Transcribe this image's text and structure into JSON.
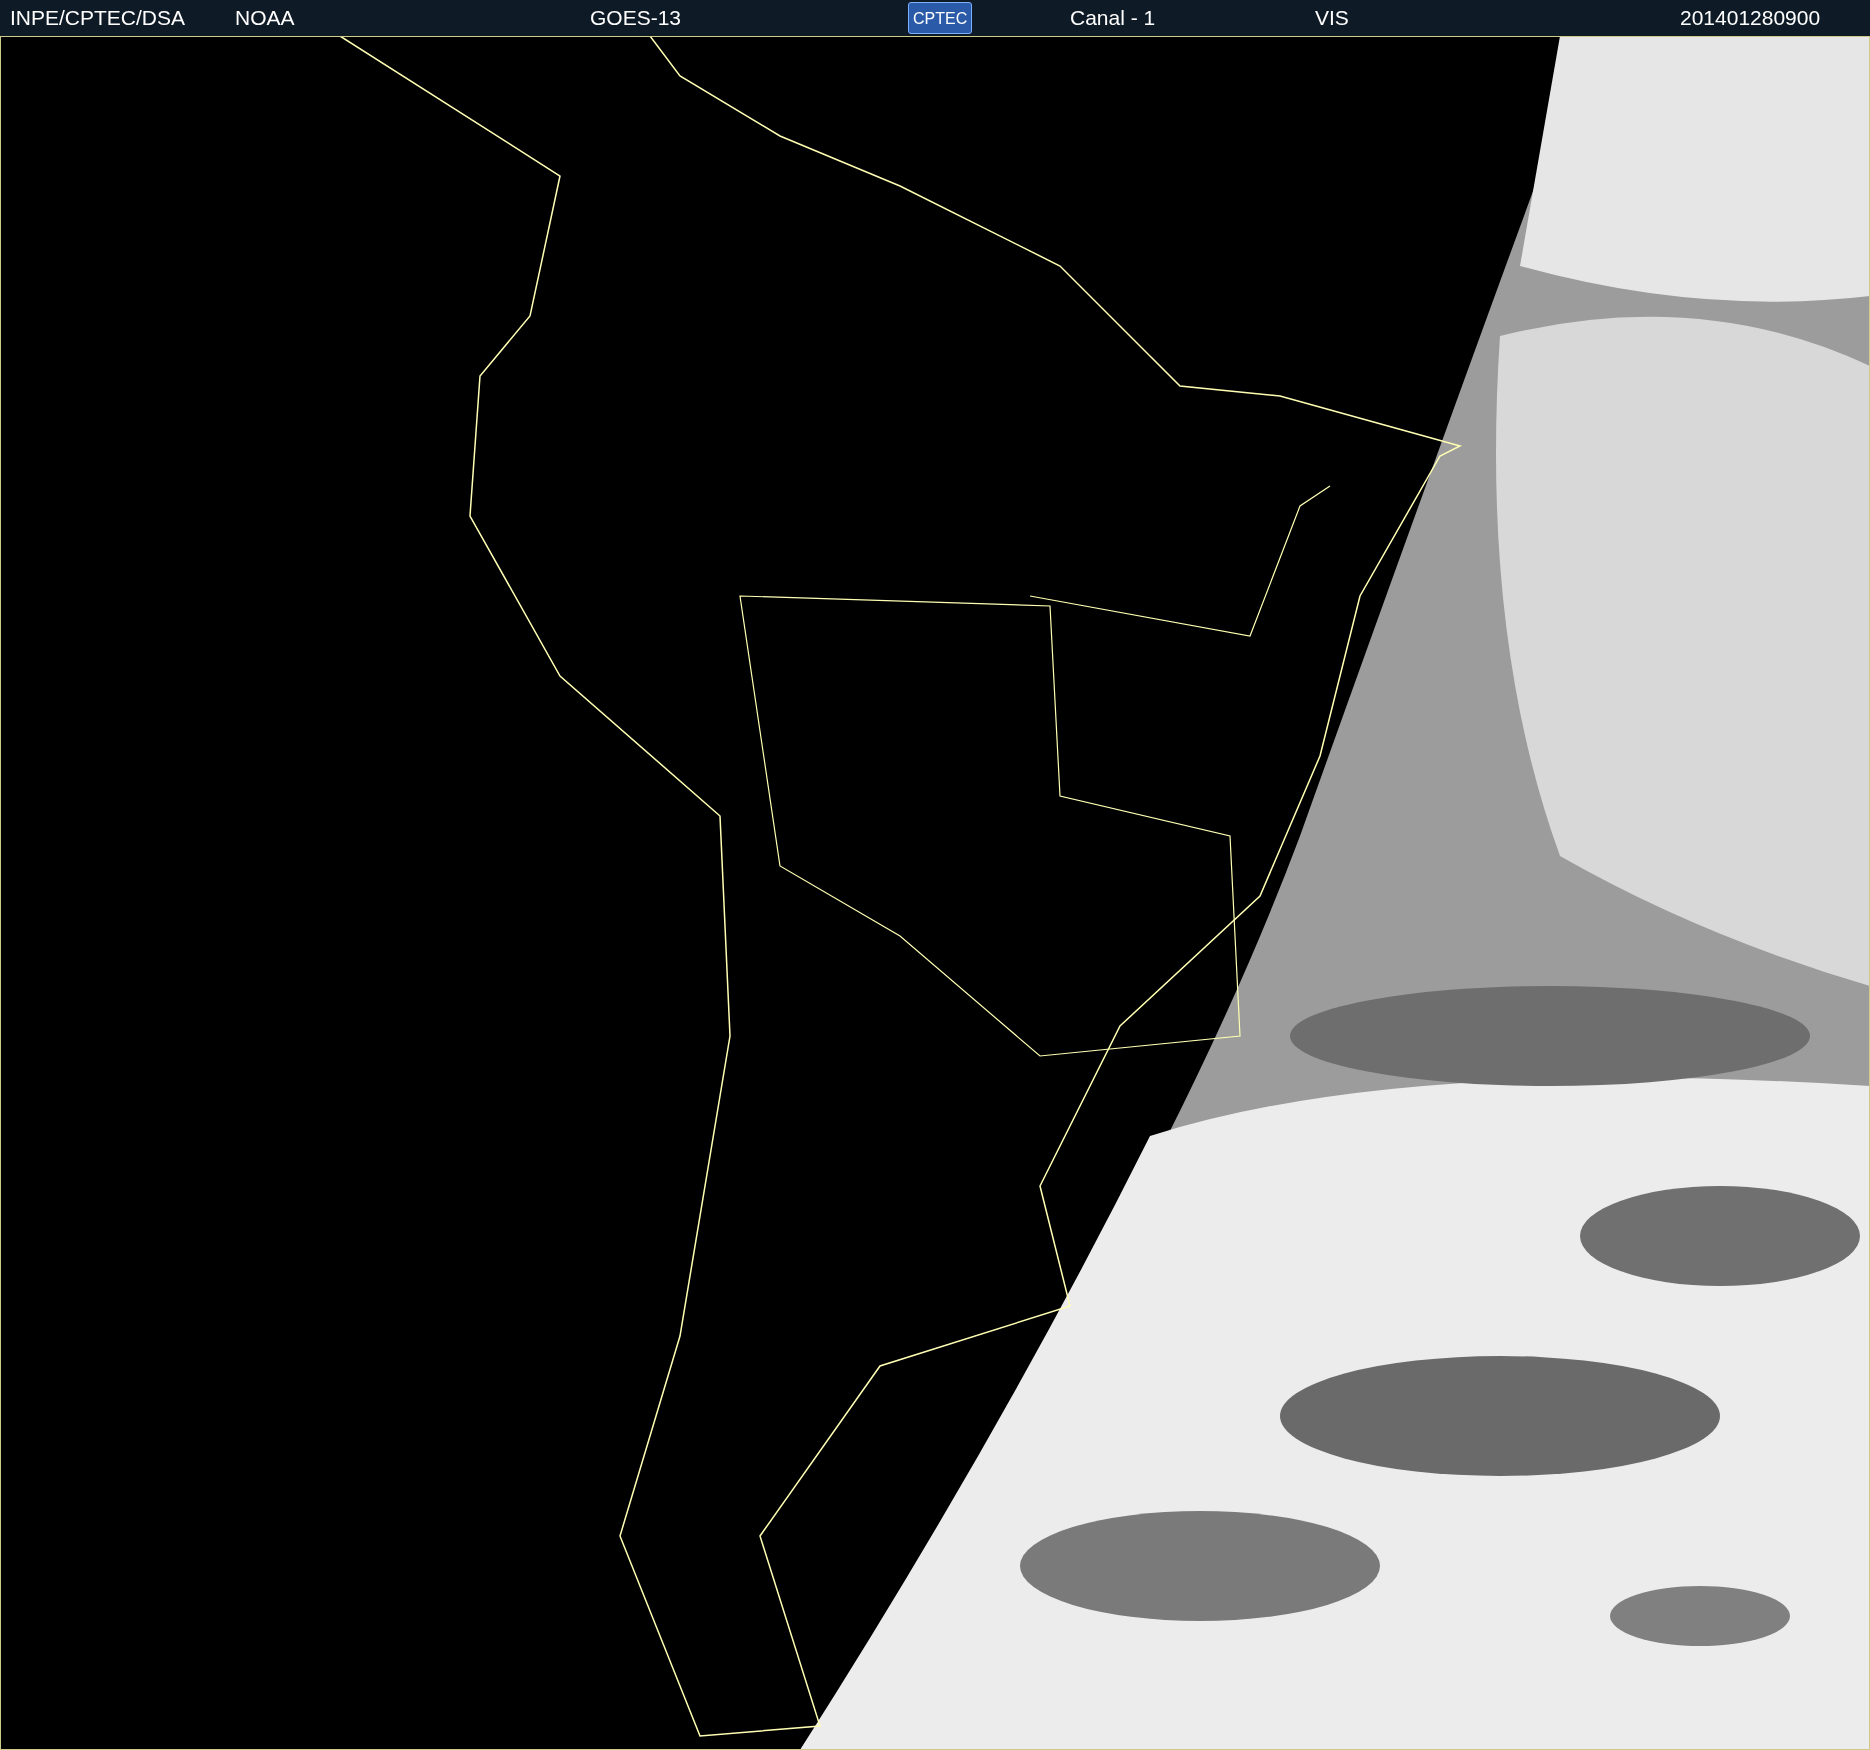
{
  "header": {
    "items": [
      {
        "kind": "text",
        "text": "INPE/CPTEC/DSA"
      },
      {
        "kind": "text",
        "text": "NOAA"
      },
      {
        "kind": "text",
        "text": "GOES-13"
      },
      {
        "kind": "logo",
        "text": "CPTEC"
      },
      {
        "kind": "text",
        "text": "Canal - 1"
      },
      {
        "kind": "text",
        "text": "VIS"
      },
      {
        "kind": "text",
        "text": "201401280900"
      }
    ]
  }
}
